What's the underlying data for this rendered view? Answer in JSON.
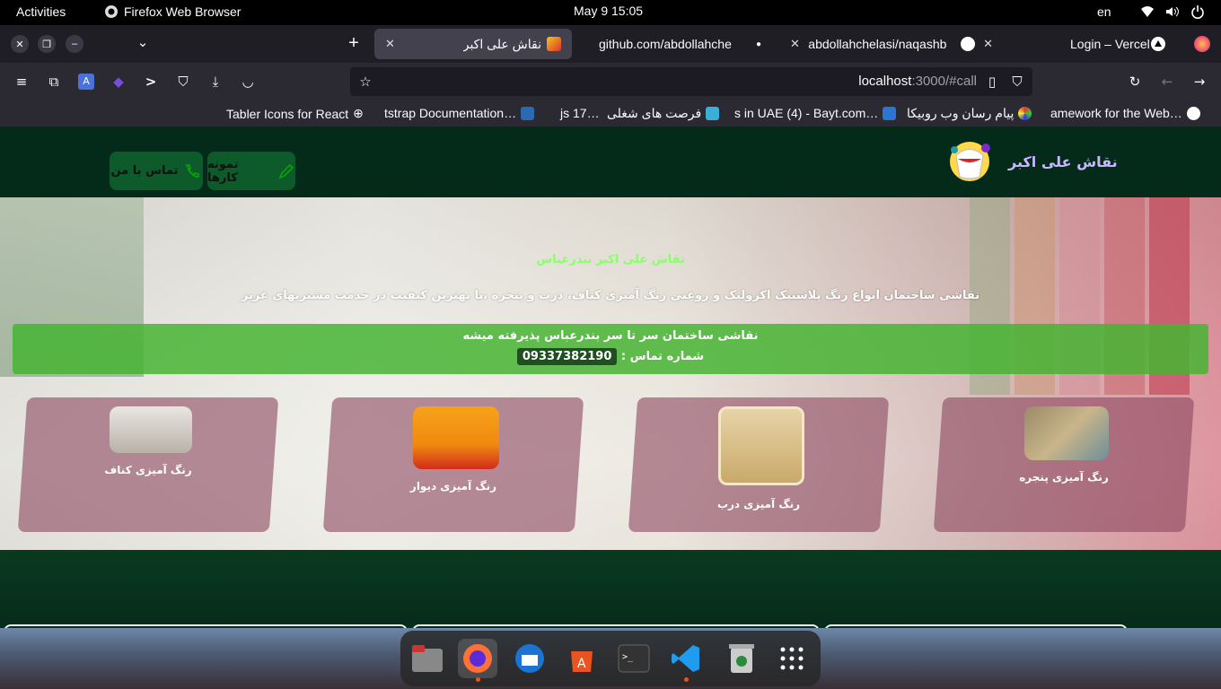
{
  "topbar": {
    "activities": "Activities",
    "app_name": "Firefox Web Browser",
    "clock": "May 9  15:05",
    "lang": "en"
  },
  "tabs": [
    {
      "title": "نقاش علی اکبر",
      "active": true
    },
    {
      "title": "github.com/abdollahche"
    },
    {
      "title": "abdollahchelasi/naqashb"
    },
    {
      "title": "Login – Vercel"
    }
  ],
  "navbar": {
    "url_host": "localhost",
    "url_rest": ":3000/#call"
  },
  "bookmarks": [
    "Tabler Icons for React",
    "tstrap Documentation…",
    "js 17…",
    "فرصت های شغلی",
    "s in UAE (4) - Bayt.com…",
    "پیام رسان وب روبیکا",
    "amework for the Web…"
  ],
  "site": {
    "brand": "نقاش علی اکبر",
    "nav_portfolio": "نمونه کارها",
    "nav_contact": "تماس با من",
    "hero_title": "نقاش علی اکبر بندرعباس",
    "hero_desc": "نقاشی ساختمان انواع رنگ پلاستیک اکرولیک و روغنی رنگ آمیزی کناف، درب و پنجره ،با بهترین کیفیت در خدمت مشتریهای عزیز",
    "call_line1": "نقاشی ساختمان سر تا سر بندرعباس پذیرفته میشه",
    "call_label": "شماره تماس :",
    "call_phone": "09337382190",
    "cards": [
      {
        "caption": "رنگ آمیزی کناف"
      },
      {
        "caption": "رنگ آمیزی دیوار"
      },
      {
        "caption": "رنگ آمیزی درب"
      },
      {
        "caption": "رنگ آمیزی پنجره"
      }
    ]
  },
  "colors": {
    "header_bg": "#042a1a",
    "page_green": "#0b5a26",
    "accent_green": "#8aff6a",
    "brand_purple": "#c8b6ff",
    "card_bg": "#8c465f"
  },
  "dock": [
    "files-icon",
    "firefox-icon",
    "thunderbird-icon",
    "app-center-icon",
    "terminal-icon",
    "vscode-icon",
    "trash-icon",
    "app-grid-icon"
  ]
}
